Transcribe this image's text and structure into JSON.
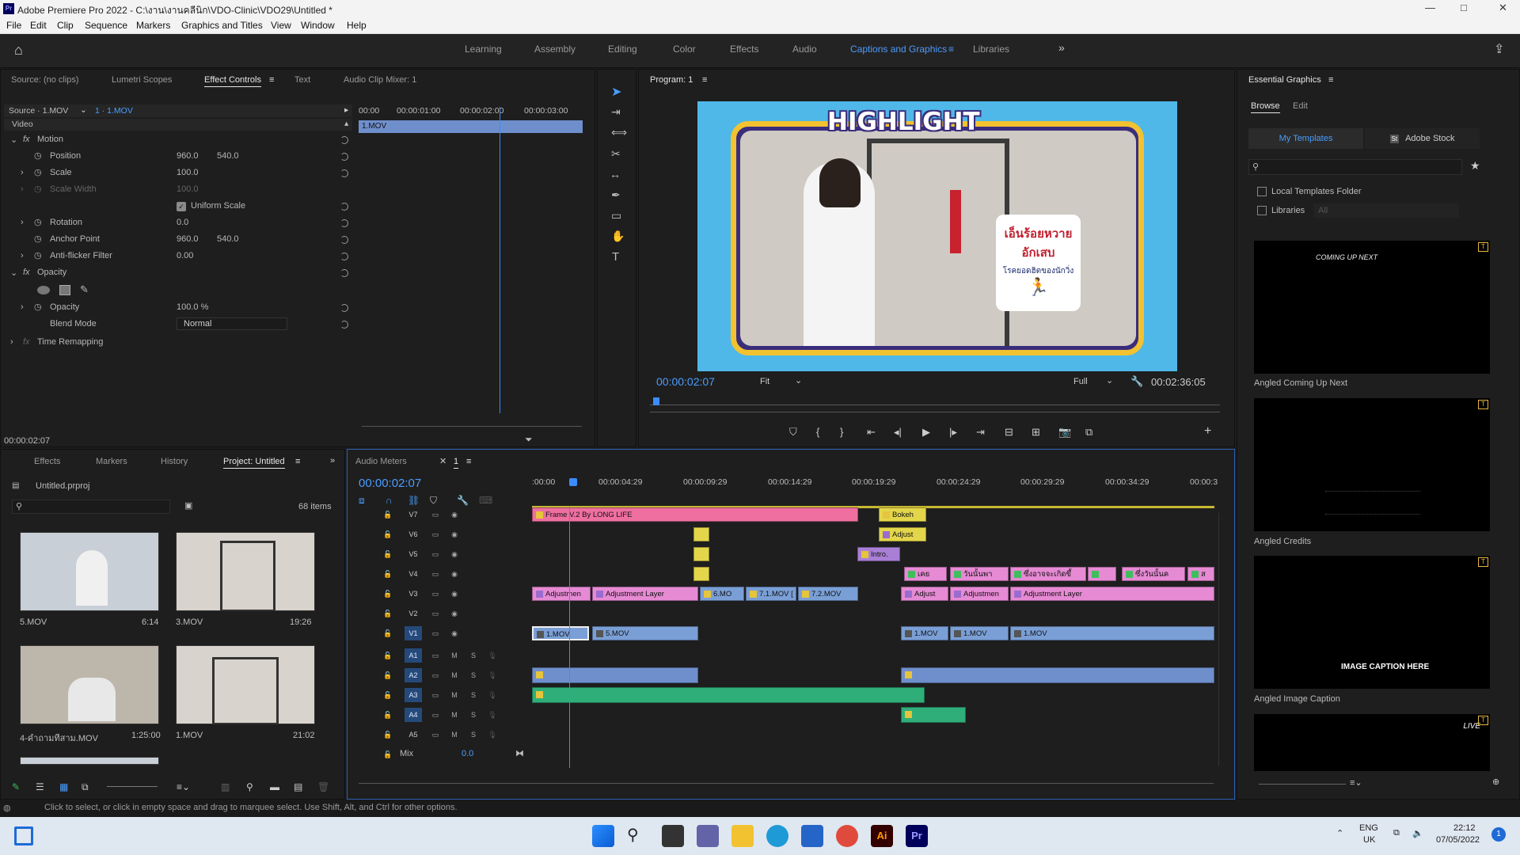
{
  "window": {
    "title": "Adobe Premiere Pro 2022 - C:\\งาน\\งานคลีนิก\\VDO-Clinic\\VDO29\\Untitled *",
    "minimize": "—",
    "maximize": "□",
    "close": "✕"
  },
  "menu": [
    "File",
    "Edit",
    "Clip",
    "Sequence",
    "Markers",
    "Graphics and Titles",
    "View",
    "Window",
    "Help"
  ],
  "workspaces": [
    "Learning",
    "Assembly",
    "Editing",
    "Color",
    "Effects",
    "Audio",
    "Captions and Graphics",
    "Libraries"
  ],
  "active_workspace": "Captions and Graphics",
  "overflow_glyph": "»",
  "source_panel": {
    "tabs": [
      "Source: (no clips)",
      "Lumetri Scopes",
      "Effect Controls",
      "Text",
      "Audio Clip Mixer: 1"
    ],
    "active_tab": "Effect Controls",
    "source_clip": "Source · 1.MOV",
    "sequence_clip": "1 · 1.MOV",
    "section_video": "Video",
    "mini_ruler": [
      "00:00",
      "00:00:01:00",
      "00:00:02:00",
      "00:00:03:00"
    ],
    "mini_clip": "1.MOV",
    "props": [
      {
        "name": "Motion",
        "kind": "group"
      },
      {
        "name": "Position",
        "v1": "960.0",
        "v2": "540.0"
      },
      {
        "name": "Scale",
        "v1": "100.0",
        "v2": ""
      },
      {
        "name": "Scale Width",
        "v1": "100.0",
        "v2": "",
        "disabled": true
      },
      {
        "name": "Uniform Scale",
        "kind": "checkbox"
      },
      {
        "name": "Rotation",
        "v1": "0.0",
        "v2": ""
      },
      {
        "name": "Anchor Point",
        "v1": "960.0",
        "v2": "540.0"
      },
      {
        "name": "Anti-flicker Filter",
        "v1": "0.00",
        "v2": ""
      },
      {
        "name": "Opacity",
        "kind": "group"
      },
      {
        "name": "Opacity",
        "v1": "100.0 %",
        "v2": ""
      },
      {
        "name": "Blend Mode",
        "v1": "Normal",
        "v2": ""
      },
      {
        "name": "Time Remapping",
        "kind": "group"
      }
    ],
    "timecode": "00:00:02:07"
  },
  "program": {
    "title": "Program: 1",
    "timecode": "00:00:02:07",
    "fit": "Fit",
    "quality": "Full",
    "duration": "00:02:36:05",
    "overlay_title": "HIGHLIGHT",
    "sign_line1": "เอ็นร้อยหวาย",
    "sign_line2": "อักเสบ",
    "sign_line3": "โรคยอดฮิตของนักวิ่ง"
  },
  "essential_graphics": {
    "title": "Essential Graphics",
    "tabs": [
      "Browse",
      "Edit"
    ],
    "subtabs": [
      "My Templates",
      "Adobe Stock"
    ],
    "local_folder": "Local Templates Folder",
    "libraries": "Libraries",
    "libraries_value": "All",
    "templates": [
      {
        "name": "Angled Coming Up Next",
        "text": "COMING UP NEXT"
      },
      {
        "name": "Angled Credits",
        "text": ""
      },
      {
        "name": "Angled Image Caption",
        "text": "IMAGE CAPTION HERE"
      },
      {
        "name": "",
        "text": "LIVE"
      }
    ]
  },
  "project": {
    "tabs": [
      "Effects",
      "Markers",
      "History",
      "Project: Untitled"
    ],
    "active_tab": "Project: Untitled",
    "file": "Untitled.prproj",
    "items_count": "68 items",
    "items": [
      {
        "name": "5.MOV",
        "dur": "6:14"
      },
      {
        "name": "3.MOV",
        "dur": "19:26"
      },
      {
        "name": "4-คำถามทีสาม.MOV",
        "dur": "1:25:00"
      },
      {
        "name": "1.MOV",
        "dur": "21:02"
      }
    ]
  },
  "timeline": {
    "tabs": [
      "Audio Meters",
      "1"
    ],
    "timecode": "00:00:02:07",
    "ruler": [
      ":00:00",
      "00:00:04:29",
      "00:00:09:29",
      "00:00:14:29",
      "00:00:19:29",
      "00:00:24:29",
      "00:00:29:29",
      "00:00:34:29",
      "00:00:3"
    ],
    "video_tracks": [
      "V7",
      "V6",
      "V5",
      "V4",
      "V3",
      "V2",
      "V1"
    ],
    "audio_tracks": [
      "A1",
      "A2",
      "A3",
      "A4",
      "A5"
    ],
    "mix_label": "Mix",
    "mix_value": "0.0",
    "clips": {
      "frame": "Frame V.2 By LONG LIFE",
      "bokeh": "Bokeh",
      "adjust": "Adjust",
      "intro": "Intro.",
      "v4a": "เคย",
      "v4b": "วันนั้นพา",
      "v4c": "ซึ่งอาจจะเกิดขึ้",
      "v4d": "ซึ่งวันนั้นค",
      "v4e": "ส",
      "v3a": "Adjustmen",
      "v3b": "Adjustment Layer",
      "v3c": "6.MO",
      "v3d": "7.1.MOV [",
      "v3e": "7.2.MOV",
      "v3f": "Adjust",
      "v3g": "Adjustmen",
      "v3h": "Adjustment Layer",
      "v1a": "1.MOV",
      "v1b": "5.MOV",
      "v1c": "1.MOV",
      "v1d": "1.MOV",
      "v1e": "1.MOV"
    }
  },
  "status": "Click to select, or click in empty space and drag to marquee select. Use Shift, Alt, and Ctrl for other options.",
  "tray": {
    "lang1": "ENG",
    "lang2": "UK",
    "time": "22:12",
    "date": "07/05/2022",
    "badge": "1"
  }
}
